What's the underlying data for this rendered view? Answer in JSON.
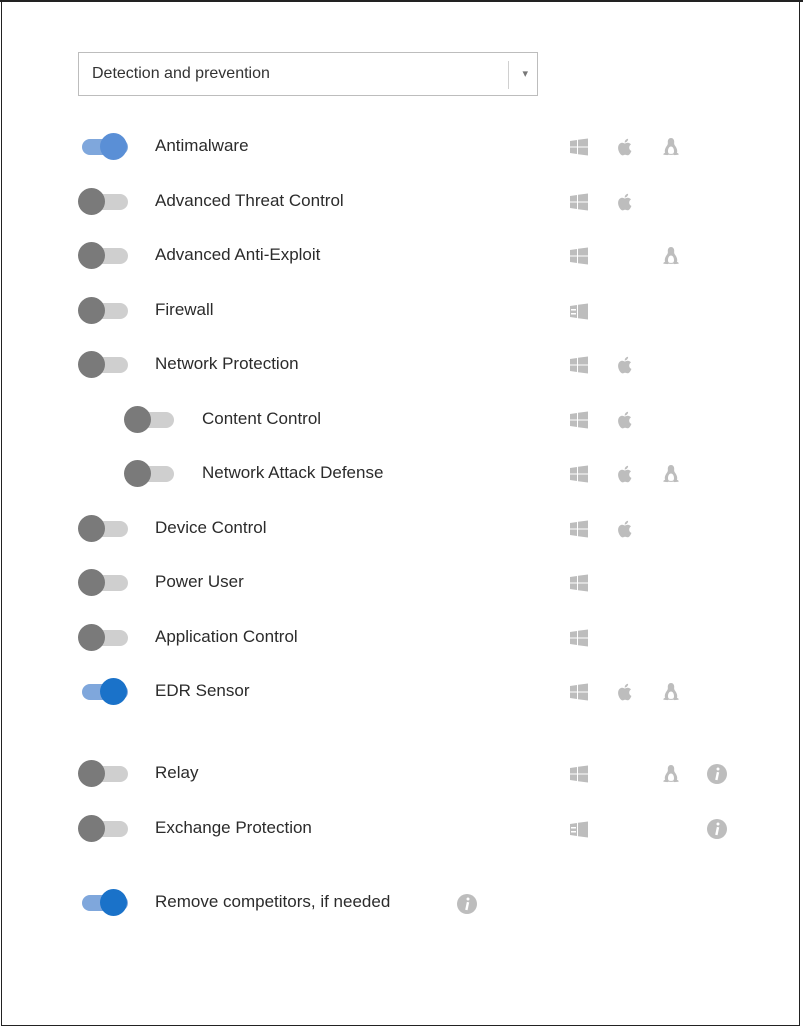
{
  "dropdown": {
    "value": "Detection and prevention",
    "arrow": "▾"
  },
  "modules": [
    {
      "label": "Antimalware",
      "enabled": true,
      "indent": false,
      "platforms": [
        "windows",
        "apple",
        "linux"
      ],
      "info": false
    },
    {
      "label": "Advanced Threat Control",
      "enabled": false,
      "indent": false,
      "platforms": [
        "windows",
        "apple"
      ],
      "info": false
    },
    {
      "label": "Advanced Anti-Exploit",
      "enabled": false,
      "indent": false,
      "platforms": [
        "windows",
        "linux"
      ],
      "info": false
    },
    {
      "label": "Firewall",
      "enabled": false,
      "indent": false,
      "platforms": [
        "windows-server"
      ],
      "info": false
    },
    {
      "label": "Network Protection",
      "enabled": false,
      "indent": false,
      "platforms": [
        "windows",
        "apple"
      ],
      "info": false
    },
    {
      "label": "Content Control",
      "enabled": false,
      "indent": true,
      "platforms": [
        "windows",
        "apple"
      ],
      "info": false
    },
    {
      "label": "Network Attack Defense",
      "enabled": false,
      "indent": true,
      "platforms": [
        "windows",
        "apple",
        "linux"
      ],
      "info": false
    },
    {
      "label": "Device Control",
      "enabled": false,
      "indent": false,
      "platforms": [
        "windows",
        "apple"
      ],
      "info": false
    },
    {
      "label": "Power User",
      "enabled": false,
      "indent": false,
      "platforms": [
        "windows"
      ],
      "info": false
    },
    {
      "label": "Application Control",
      "enabled": false,
      "indent": false,
      "platforms": [
        "windows"
      ],
      "info": false
    },
    {
      "label": "EDR Sensor",
      "enabled": true,
      "indent": false,
      "platforms": [
        "windows",
        "apple",
        "linux"
      ],
      "info": false
    },
    {
      "label": "Relay",
      "enabled": false,
      "indent": false,
      "platforms": [
        "windows",
        "linux"
      ],
      "info": true
    },
    {
      "label": "Exchange Protection",
      "enabled": false,
      "indent": false,
      "platforms": [
        "windows-server"
      ],
      "info": true
    }
  ],
  "remove_competitors": {
    "label": "Remove competitors, if needed",
    "enabled": true,
    "info": true
  },
  "colors": {
    "toggle_on_knob": "#1a72c9",
    "toggle_on_track": "#7fa7dc",
    "toggle_off_knob": "#7a7a7a",
    "toggle_off_track": "#cfcfcf",
    "platform_icon": "#bdbdbd"
  },
  "icons": {
    "windows": "windows-icon",
    "windows-server": "windows-server-icon",
    "apple": "apple-icon",
    "linux": "linux-icon",
    "info": "info-icon"
  }
}
